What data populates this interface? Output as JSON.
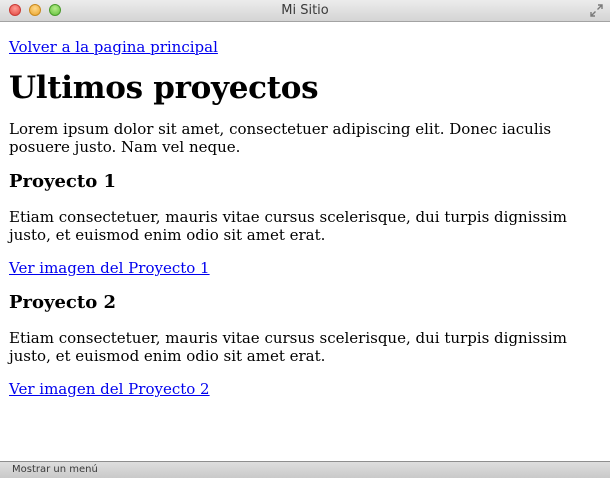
{
  "window": {
    "title": "Mi Sitio"
  },
  "page": {
    "back_link": "Volver a la pagina principal",
    "heading": "Ultimos proyectos",
    "intro": "Lorem ipsum dolor sit amet, consectetuer adipiscing elit. Donec iaculis posuere justo. Nam vel neque.",
    "projects": [
      {
        "title": "Proyecto 1",
        "description": "Etiam consectetuer, mauris vitae cursus scelerisque, dui turpis dignissim justo, et euismod enim odio sit amet erat.",
        "link": "Ver imagen del Proyecto 1"
      },
      {
        "title": "Proyecto 2",
        "description": "Etiam consectetuer, mauris vitae cursus scelerisque, dui turpis dignissim justo, et euismod enim odio sit amet erat.",
        "link": "Ver imagen del Proyecto 2"
      }
    ]
  },
  "statusbar": {
    "text": "Mostrar un menú"
  },
  "colors": {
    "link": "#0000ee",
    "text": "#000000",
    "close_button": "#e0443e",
    "minimize_button": "#e9a32b",
    "zoom_button": "#5fbf3a"
  },
  "icons": {
    "close": "close-icon",
    "minimize": "minimize-icon",
    "zoom": "zoom-icon",
    "fullscreen": "fullscreen-arrows-icon"
  }
}
